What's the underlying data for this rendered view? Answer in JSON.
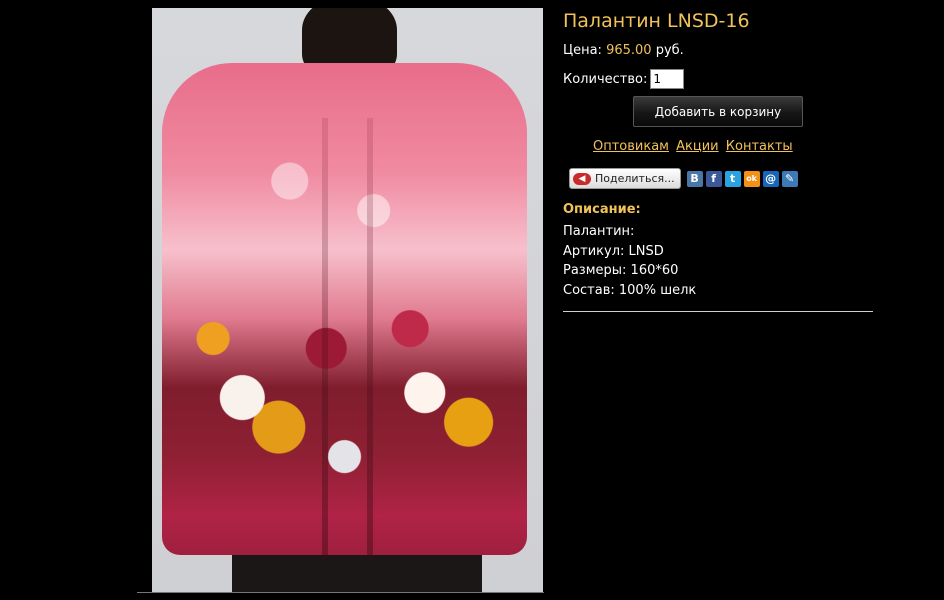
{
  "product": {
    "title": "Палантин LNSD-16",
    "price_label": "Цена:",
    "price_value": "965.00",
    "price_currency": "руб.",
    "qty_label": "Количество:",
    "qty_value": "1",
    "cart_button": "Добавить в корзину"
  },
  "links": [
    "Оптовикам",
    "Акции",
    "Контакты"
  ],
  "share": {
    "button_label": "Поделиться...",
    "networks": [
      {
        "icon": "vkontakte-icon",
        "glyph": "В",
        "color": "#4a76a8"
      },
      {
        "icon": "facebook-icon",
        "glyph": "f",
        "color": "#3b5998"
      },
      {
        "icon": "twitter-icon",
        "glyph": "t",
        "color": "#2ba3e0"
      },
      {
        "icon": "odnoklassniki-icon",
        "glyph": "ok",
        "color": "#f39018"
      },
      {
        "icon": "mail-icon",
        "glyph": "@",
        "color": "#1866b7"
      },
      {
        "icon": "livejournal-icon",
        "glyph": "✎",
        "color": "#3d7bb6"
      }
    ]
  },
  "description": {
    "title": "Описание:",
    "lines": [
      "Палантин:",
      "Артикул: LNSD",
      "Размеры: 160*60",
      "Состав: 100% шелк"
    ]
  },
  "colors": {
    "accent": "#f2c25a",
    "background": "#000000"
  }
}
